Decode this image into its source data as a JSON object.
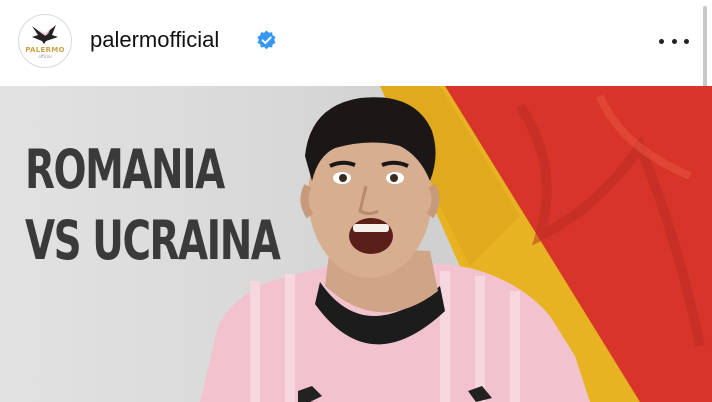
{
  "header": {
    "username": "palermofficial",
    "avatar": {
      "label": "PALERMO",
      "sublabel": "official",
      "icon": "palermo-eagle-crest-icon"
    },
    "verified_icon": "verified-badge-icon",
    "more_icon": "more-options-icon"
  },
  "post": {
    "headline_line1": "ROMANIA",
    "headline_line2": "VS UCRAINA",
    "image": "player-photo",
    "colors": {
      "background": "#d8d8d8",
      "flag_yellow": "#e8b322",
      "flag_red": "#d8352a",
      "jersey_pink": "#f2c3cf",
      "headline_text": "#3a3a3a",
      "verified_blue": "#3897f0",
      "crest_gold": "#c9a24a"
    }
  }
}
